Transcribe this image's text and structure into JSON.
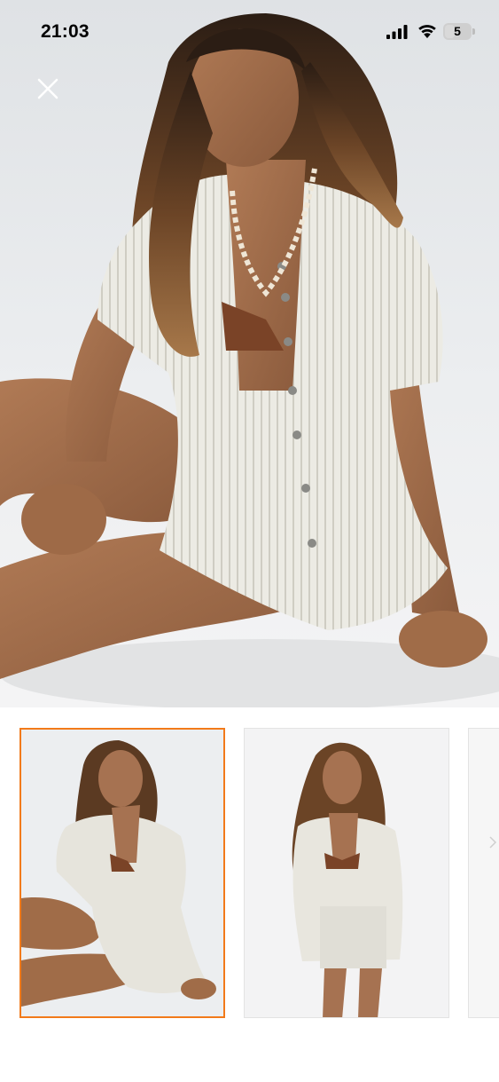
{
  "status_bar": {
    "time": "21:03",
    "battery_level": "5",
    "icons": [
      "signal-icon",
      "wifi-icon",
      "battery-icon"
    ]
  },
  "viewer": {
    "close_icon": "close-icon",
    "thumbnails": [
      {
        "selected": true
      },
      {
        "selected": false
      },
      {
        "selected": false
      }
    ]
  },
  "colors": {
    "accent": "#f27a1a",
    "background": "#ffffff",
    "photo_backdrop": "#e9ebed"
  }
}
